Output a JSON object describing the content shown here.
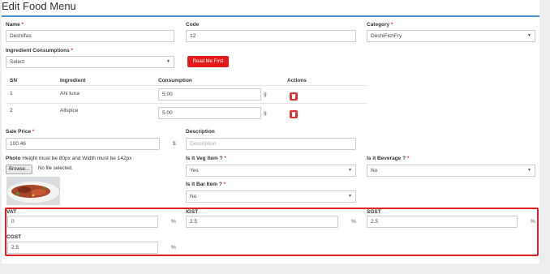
{
  "page": {
    "title": "Edit Food Menu"
  },
  "form": {
    "name": {
      "label": "Name",
      "value": "Deshilfas"
    },
    "code": {
      "label": "Code",
      "value": "12"
    },
    "category": {
      "label": "Category",
      "value": "DeshiFishFry"
    },
    "ingredient_consumptions": {
      "label": "Ingredient Consumptions",
      "value": "Select",
      "read_me_label": "Read Me First"
    },
    "table": {
      "headers": [
        "SN",
        "Ingredient",
        "Consumption",
        "Actions"
      ],
      "rows": [
        {
          "sn": "1",
          "ingredient": "Ahi tuna",
          "consumption": "5.00",
          "unit": "g"
        },
        {
          "sn": "2",
          "ingredient": "Allspice",
          "consumption": "5.00",
          "unit": "g"
        }
      ]
    },
    "sale_price": {
      "label": "Sale Price",
      "value": "100.46",
      "unit": "$"
    },
    "description": {
      "label": "Description",
      "placeholder": "Description"
    },
    "photo": {
      "label": "Photo",
      "hint": "Height must be 80px and Width must be 142px",
      "browse_label": "Browse...",
      "file_status": "No file selected."
    },
    "veg_item": {
      "label": "Is it Veg Item ?",
      "value": "Yes"
    },
    "beverage": {
      "label": "Is it Beverage ?",
      "value": "No"
    },
    "bar_item": {
      "label": "Is it Bar Item ?",
      "value": "No"
    },
    "vat": {
      "label": "VAT",
      "value": "0",
      "unit": "%"
    },
    "igst": {
      "label": "IGST",
      "value": "2.5",
      "unit": "%"
    },
    "sgst": {
      "label": "SGST",
      "value": "2.5",
      "unit": "%"
    },
    "cgst": {
      "label": "CGST",
      "value": "2.5",
      "unit": "%"
    }
  },
  "colors": {
    "accent": "#4d8fd6",
    "danger": "#e31b1b",
    "highlight_border": "#e02020"
  }
}
